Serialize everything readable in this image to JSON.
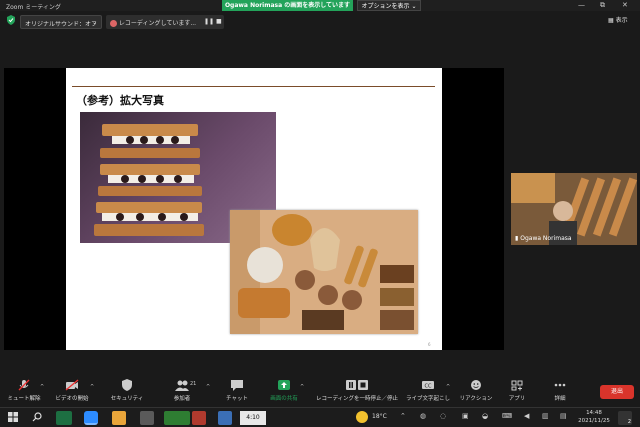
{
  "titlebar": {
    "app_title": "Zoom ミーティング",
    "share_banner": "Ogawa Norimasa の画面を表示しています",
    "options_button": "オプションを表示 ⌄"
  },
  "controls": {
    "minimize": "—",
    "restore": "⧉",
    "close": "✕"
  },
  "topbar": {
    "audio_select": "オリジナルサウンド：オフ",
    "recording_status": "レコーディングしています...",
    "view_label": "表示"
  },
  "slide": {
    "title": "（参考）拡大写真",
    "page_number": "6"
  },
  "participant": {
    "name": "Ogawa Norimasa"
  },
  "toolbar": {
    "unmute": "ミュート解除",
    "video": "ビデオの開始",
    "security": "セキュリティ",
    "participants": "参加者",
    "participants_count": "21",
    "chat": "チャット",
    "share": "画面の共有",
    "recording_pause": "レコーディングを一時停止／停止",
    "captions": "ライブ文字起こし",
    "reactions": "リアクション",
    "apps": "アプリ",
    "more": "詳細",
    "leave": "退出"
  },
  "taskbar": {
    "weather": "18°C",
    "time": "14:48",
    "date": "2021/11/25",
    "meter": "4:10",
    "notification_count": "2"
  }
}
